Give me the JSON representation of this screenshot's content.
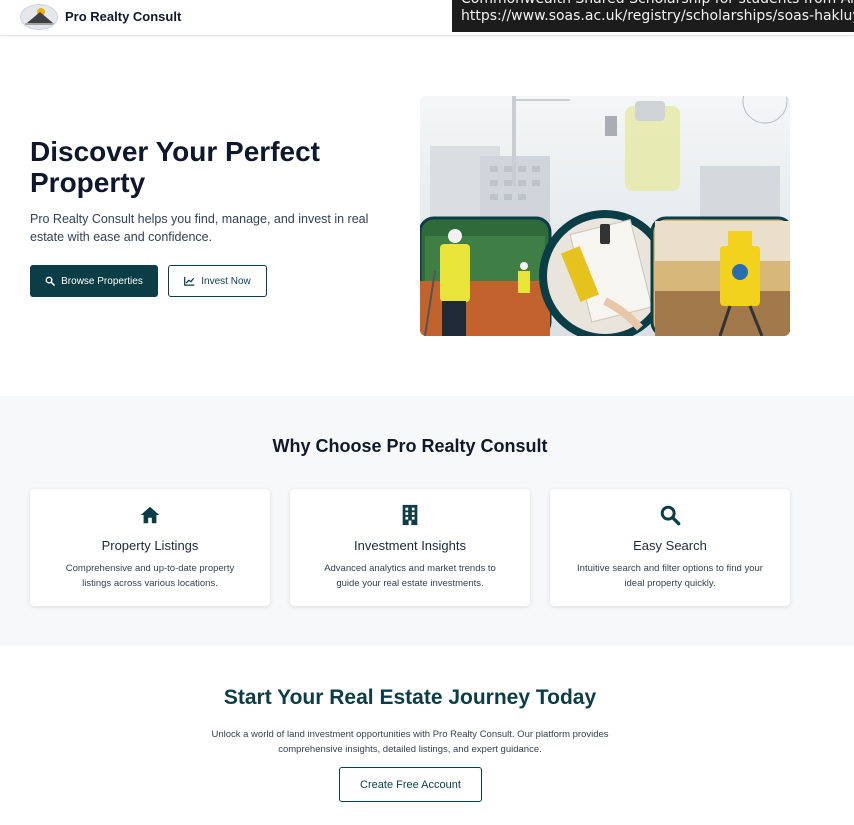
{
  "navbar": {
    "brand_name": "Pro Realty Consult"
  },
  "tooltip": {
    "line1": "Commonwealth Shared Scholarship for students from Africa",
    "line2": "https://www.soas.ac.uk/registry/scholarships/soas-hakluyt-"
  },
  "hero": {
    "title": "Discover Your Perfect Property",
    "subtitle": "Pro Realty Consult helps you find, manage, and invest in real estate with ease and confidence.",
    "primary_button": "Browse Properties",
    "primary_icon": "search-icon",
    "secondary_button": "Invest Now",
    "secondary_icon": "chart-line-icon"
  },
  "features": {
    "title": "Why Choose Pro Realty Consult",
    "cards": [
      {
        "icon": "home-icon",
        "title": "Property Listings",
        "description": "Comprehensive and up-to-date property listings across various locations."
      },
      {
        "icon": "building-icon",
        "title": "Investment Insights",
        "description": "Advanced analytics and market trends to guide your real estate investments."
      },
      {
        "icon": "search-icon",
        "title": "Easy Search",
        "description": "Intuitive search and filter options to find your ideal property quickly."
      }
    ]
  },
  "cta": {
    "title": "Start Your Real Estate Journey Today",
    "description": "Unlock a world of land investment opportunities with Pro Realty Consult. Our platform provides comprehensive insights, detailed listings, and expert guidance.",
    "button": "Create Free Account"
  },
  "colors": {
    "brand_dark": "#0b3d46",
    "section_bg": "#f7f8fa",
    "safety_yellow": "#e6d22a"
  }
}
